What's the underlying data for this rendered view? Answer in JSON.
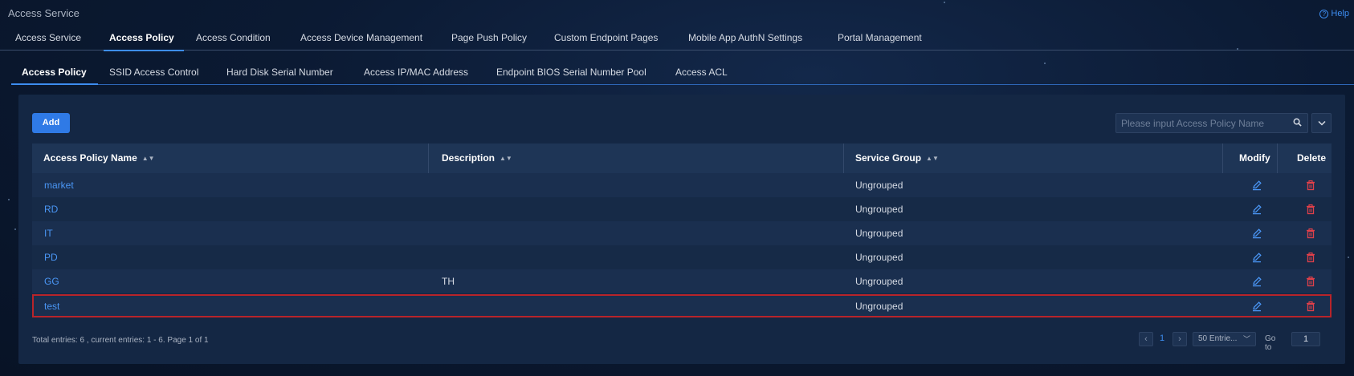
{
  "app": {
    "title": "Access Service",
    "help_label": "Help"
  },
  "main_tabs": [
    {
      "label": "Access Service",
      "active": false
    },
    {
      "label": "Access Policy",
      "active": true
    },
    {
      "label": "Access Condition",
      "active": false
    },
    {
      "label": "Access Device Management",
      "active": false
    },
    {
      "label": "Page Push Policy",
      "active": false
    },
    {
      "label": "Custom Endpoint Pages",
      "active": false
    },
    {
      "label": "Mobile App AuthN Settings",
      "active": false
    },
    {
      "label": "Portal Management",
      "active": false
    }
  ],
  "sub_tabs": [
    {
      "label": "Access Policy",
      "active": true
    },
    {
      "label": "SSID Access Control",
      "active": false
    },
    {
      "label": "Hard Disk Serial Number",
      "active": false
    },
    {
      "label": "Access IP/MAC Address",
      "active": false
    },
    {
      "label": "Endpoint BIOS Serial Number Pool",
      "active": false
    },
    {
      "label": "Access ACL",
      "active": false
    }
  ],
  "toolbar": {
    "add_label": "Add",
    "search_placeholder": "Please input Access Policy Name",
    "search_value": ""
  },
  "table": {
    "columns": {
      "name": "Access Policy Name",
      "description": "Description",
      "service_group": "Service Group",
      "modify": "Modify",
      "delete": "Delete"
    },
    "rows": [
      {
        "name": "market",
        "description": "",
        "service_group": "Ungrouped",
        "selected": false
      },
      {
        "name": "RD",
        "description": "",
        "service_group": "Ungrouped",
        "selected": false
      },
      {
        "name": "IT",
        "description": "",
        "service_group": "Ungrouped",
        "selected": false
      },
      {
        "name": "PD",
        "description": "",
        "service_group": "Ungrouped",
        "selected": false
      },
      {
        "name": "GG",
        "description": "TH",
        "service_group": "Ungrouped",
        "selected": false
      },
      {
        "name": "test",
        "description": "",
        "service_group": "Ungrouped",
        "selected": true
      }
    ]
  },
  "footer": {
    "summary": "Total entries: 6 , current entries: 1 - 6. Page 1 of 1",
    "current_page": "1",
    "page_size_label": "50 Entrie...",
    "goto_label": "Go to",
    "goto_value": "1"
  },
  "colors": {
    "accent": "#3d8df0",
    "link": "#4a96f5",
    "delete": "#e0404a",
    "selected_border": "#b8242a"
  }
}
